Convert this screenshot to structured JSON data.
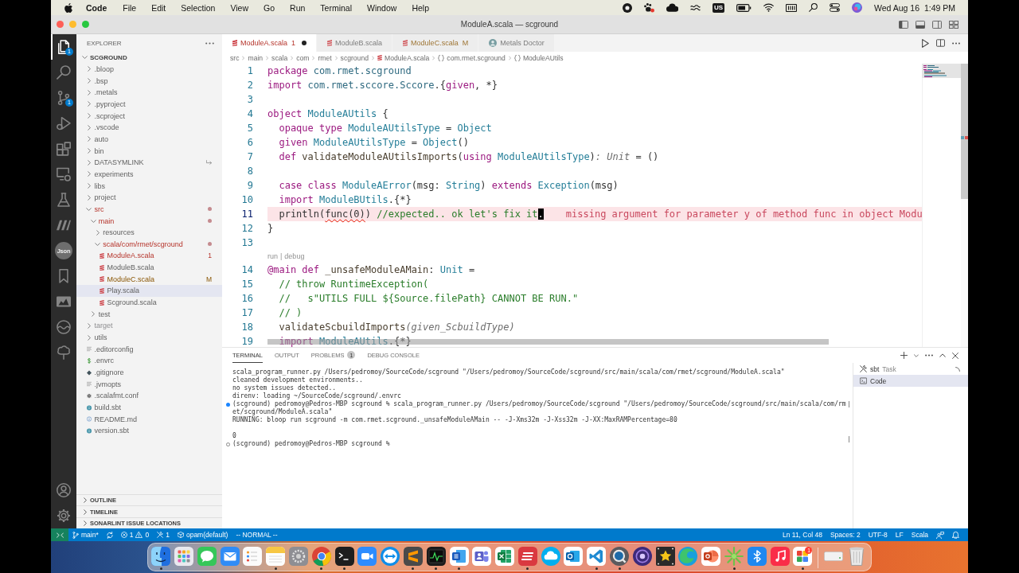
{
  "menubar": {
    "app": "Code",
    "menus": [
      "File",
      "Edit",
      "Selection",
      "View",
      "Go",
      "Run",
      "Terminal",
      "Window",
      "Help"
    ],
    "input_source": "US",
    "clock": "Wed Aug 16  1:49 PM"
  },
  "window": {
    "title": "ModuleA.scala — scground"
  },
  "activity_bar": {
    "items": [
      {
        "kind": "explorer",
        "selected": true,
        "badge": "1"
      },
      {
        "kind": "search",
        "selected": false
      },
      {
        "kind": "scm",
        "selected": false,
        "badge": "1"
      },
      {
        "kind": "debug",
        "selected": false
      },
      {
        "kind": "extensions",
        "selected": false
      },
      {
        "kind": "remote",
        "selected": false
      },
      {
        "kind": "testing",
        "selected": false
      },
      {
        "kind": "bars",
        "selected": false
      },
      {
        "kind": "json",
        "selected": false,
        "text": "Json"
      },
      {
        "kind": "bookmarks",
        "selected": false
      },
      {
        "kind": "image",
        "selected": false
      },
      {
        "kind": "wave",
        "selected": false
      },
      {
        "kind": "tree",
        "selected": false
      }
    ]
  },
  "sidebar": {
    "title": "EXPLORER",
    "root": {
      "label": "SCGROUND",
      "expanded": true,
      "children": [
        {
          "label": ".bloop",
          "kind": "folder",
          "expanded": false,
          "selected": false,
          "problems": false,
          "modified": false,
          "ignored": false
        },
        {
          "label": ".bsp",
          "kind": "folder",
          "expanded": false,
          "selected": false,
          "problems": false,
          "modified": false,
          "ignored": false
        },
        {
          "label": ".metals",
          "kind": "folder",
          "expanded": false,
          "selected": false,
          "problems": false,
          "modified": false,
          "ignored": false
        },
        {
          "label": ".pyproject",
          "kind": "folder",
          "expanded": false,
          "selected": false,
          "problems": false,
          "modified": false,
          "ignored": false
        },
        {
          "label": ".scproject",
          "kind": "folder",
          "expanded": false,
          "selected": false,
          "problems": false,
          "modified": false,
          "ignored": false
        },
        {
          "label": ".vscode",
          "kind": "folder",
          "expanded": false,
          "selected": false,
          "problems": false,
          "modified": false,
          "ignored": false
        },
        {
          "label": "auto",
          "kind": "folder",
          "expanded": false,
          "selected": false,
          "problems": false,
          "modified": false,
          "ignored": false
        },
        {
          "label": "bin",
          "kind": "folder",
          "expanded": false,
          "selected": false,
          "problems": false,
          "modified": false,
          "ignored": false
        },
        {
          "label": "DATASYMLINK",
          "kind": "link",
          "expanded": false,
          "selected": false,
          "problems": false,
          "modified": false,
          "ignored": false
        },
        {
          "label": "experiments",
          "kind": "folder",
          "expanded": false,
          "selected": false,
          "problems": false,
          "modified": false,
          "ignored": false
        },
        {
          "label": "libs",
          "kind": "folder",
          "expanded": false,
          "selected": false,
          "problems": false,
          "modified": false,
          "ignored": false
        },
        {
          "label": "project",
          "kind": "folder",
          "expanded": false,
          "selected": false,
          "problems": false,
          "modified": false,
          "ignored": false
        },
        {
          "label": "src",
          "kind": "folder",
          "expanded": true,
          "selected": false,
          "problems": true,
          "modified": false,
          "ignored": false,
          "children": [
            {
              "label": "main",
              "kind": "folder",
              "expanded": true,
              "selected": false,
              "problems": true,
              "modified": false,
              "ignored": false,
              "children": [
                {
                  "label": "resources",
                  "kind": "folder",
                  "expanded": false,
                  "selected": false,
                  "problems": false,
                  "modified": false,
                  "ignored": false
                },
                {
                  "label": "scala/com/rmet/scground",
                  "kind": "folder",
                  "expanded": true,
                  "selected": false,
                  "problems": true,
                  "modified": false,
                  "ignored": false,
                  "children": [
                    {
                      "label": "ModuleA.scala",
                      "kind": "scala",
                      "selected": false,
                      "problems": true,
                      "modified": false,
                      "ignored": false,
                      "badge": "1"
                    },
                    {
                      "label": "ModuleB.scala",
                      "kind": "scala",
                      "selected": false,
                      "problems": false,
                      "modified": false,
                      "ignored": false
                    },
                    {
                      "label": "ModuleC.scala",
                      "kind": "scala",
                      "selected": false,
                      "problems": false,
                      "modified": true,
                      "ignored": false,
                      "badge": "M"
                    },
                    {
                      "label": "Play.scala",
                      "kind": "scala",
                      "selected": true,
                      "problems": false,
                      "modified": false,
                      "ignored": false
                    },
                    {
                      "label": "Scground.scala",
                      "kind": "scala",
                      "selected": false,
                      "problems": false,
                      "modified": false,
                      "ignored": false
                    }
                  ]
                }
              ]
            },
            {
              "label": "test",
              "kind": "folder",
              "expanded": false,
              "selected": false,
              "problems": false,
              "modified": false,
              "ignored": false
            }
          ]
        },
        {
          "label": "target",
          "kind": "folder",
          "expanded": false,
          "selected": false,
          "problems": false,
          "modified": false,
          "ignored": true
        },
        {
          "label": "utils",
          "kind": "folder",
          "expanded": false,
          "selected": false,
          "problems": false,
          "modified": false,
          "ignored": false
        },
        {
          "label": ".editorconfig",
          "kind": "config",
          "selected": false,
          "problems": false,
          "modified": false,
          "ignored": false
        },
        {
          "label": ".envrc",
          "kind": "shell",
          "selected": false,
          "problems": false,
          "modified": false,
          "ignored": false
        },
        {
          "label": ".gitignore",
          "kind": "git",
          "selected": false,
          "problems": false,
          "modified": false,
          "ignored": false
        },
        {
          "label": ".jvmopts",
          "kind": "config",
          "selected": false,
          "problems": false,
          "modified": false,
          "ignored": false
        },
        {
          "label": ".scalafmt.conf",
          "kind": "gear",
          "selected": false,
          "problems": false,
          "modified": false,
          "ignored": false
        },
        {
          "label": "build.sbt",
          "kind": "sbt",
          "selected": false,
          "problems": false,
          "modified": false,
          "ignored": false
        },
        {
          "label": "README.md",
          "kind": "info",
          "selected": false,
          "problems": false,
          "modified": false,
          "ignored": false
        },
        {
          "label": "version.sbt",
          "kind": "sbt",
          "selected": false,
          "problems": false,
          "modified": false,
          "ignored": false
        }
      ]
    },
    "sections": [
      {
        "label": "OUTLINE",
        "expanded": false
      },
      {
        "label": "TIMELINE",
        "expanded": false
      },
      {
        "label": "SONARLINT ISSUE LOCATIONS",
        "expanded": false
      }
    ]
  },
  "editor": {
    "tabs": [
      {
        "label": "ModuleA.scala",
        "kind": "scala",
        "badge": "1",
        "problems": true,
        "modified": false,
        "dirty": true,
        "selected": true
      },
      {
        "label": "ModuleB.scala",
        "kind": "scala",
        "problems": false,
        "modified": false,
        "dirty": false,
        "selected": false
      },
      {
        "label": "ModuleC.scala",
        "kind": "scala",
        "badge": "M",
        "problems": false,
        "modified": true,
        "dirty": false,
        "selected": false
      },
      {
        "label": "Metals Doctor",
        "kind": "doctor",
        "problems": false,
        "modified": false,
        "dirty": false,
        "selected": false
      }
    ],
    "breadcrumbs": [
      {
        "label": "src",
        "kind": "folder"
      },
      {
        "label": "main",
        "kind": "folder"
      },
      {
        "label": "scala",
        "kind": "folder"
      },
      {
        "label": "com",
        "kind": "folder"
      },
      {
        "label": "rmet",
        "kind": "folder"
      },
      {
        "label": "scground",
        "kind": "folder"
      },
      {
        "label": "ModuleA.scala",
        "kind": "scala"
      },
      {
        "label": "com.rmet.scground",
        "kind": "package"
      },
      {
        "label": "ModuleAUtils",
        "kind": "package"
      }
    ],
    "lines": [
      {
        "kind": "code",
        "number": "1",
        "current": false,
        "tokens": [
          {
            "kind": "kw",
            "text": "package"
          },
          {
            "kind": "ns",
            "text": " com.rmet.scground"
          }
        ]
      },
      {
        "kind": "code",
        "number": "2",
        "current": false,
        "tokens": [
          {
            "kind": "kw",
            "text": "import"
          },
          {
            "kind": "ns",
            "text": " com.rmet.sccore.Sccore"
          },
          {
            "kind": "plain",
            "text": ".{"
          },
          {
            "kind": "kw",
            "text": "given"
          },
          {
            "kind": "plain",
            "text": ", *}"
          }
        ]
      },
      {
        "kind": "code",
        "number": "3",
        "current": false
      },
      {
        "kind": "code",
        "number": "4",
        "current": false,
        "tokens": [
          {
            "kind": "kw",
            "text": "object"
          },
          {
            "kind": "type",
            "text": " ModuleAUtils"
          },
          {
            "kind": "plain",
            "text": " {"
          }
        ]
      },
      {
        "kind": "code",
        "number": "5",
        "current": false,
        "tokens": [
          {
            "kind": "kw",
            "text": "  opaque type"
          },
          {
            "kind": "type",
            "text": " ModuleAUtilsType"
          },
          {
            "kind": "plain",
            "text": " = "
          },
          {
            "kind": "type",
            "text": "Object"
          }
        ]
      },
      {
        "kind": "code",
        "number": "6",
        "current": false,
        "tokens": [
          {
            "kind": "kw",
            "text": "  given"
          },
          {
            "kind": "type",
            "text": " ModuleAUtilsType"
          },
          {
            "kind": "plain",
            "text": " = "
          },
          {
            "kind": "type",
            "text": "Object"
          },
          {
            "kind": "plain",
            "text": "()"
          }
        ]
      },
      {
        "kind": "code",
        "number": "7",
        "current": false,
        "tokens": [
          {
            "kind": "kw",
            "text": "  def"
          },
          {
            "kind": "fn",
            "text": " validateModuleAUtilsImports"
          },
          {
            "kind": "plain",
            "text": "("
          },
          {
            "kind": "kw",
            "text": "using"
          },
          {
            "kind": "type",
            "text": " ModuleAUtilsType"
          },
          {
            "kind": "plain",
            "text": ")"
          },
          {
            "kind": "hint",
            "text": ": Unit"
          },
          {
            "kind": "plain",
            "text": " = ()"
          }
        ]
      },
      {
        "kind": "code",
        "number": "8",
        "current": false
      },
      {
        "kind": "code",
        "number": "9",
        "current": false,
        "tokens": [
          {
            "kind": "kw",
            "text": "  case class"
          },
          {
            "kind": "type",
            "text": " ModuleAError"
          },
          {
            "kind": "plain",
            "text": "(msg: "
          },
          {
            "kind": "type",
            "text": "String"
          },
          {
            "kind": "plain",
            "text": ") "
          },
          {
            "kind": "kw",
            "text": "extends"
          },
          {
            "kind": "type",
            "text": " Exception"
          },
          {
            "kind": "plain",
            "text": "(msg)"
          }
        ]
      },
      {
        "kind": "code",
        "number": "10",
        "current": false,
        "tokens": [
          {
            "kind": "kw",
            "text": "  import"
          },
          {
            "kind": "type",
            "text": " ModuleBUtils"
          },
          {
            "kind": "plain",
            "text": ".{*}"
          }
        ]
      },
      {
        "kind": "code",
        "number": "11",
        "current": true,
        "tokens": [
          {
            "kind": "plain",
            "text": "  println("
          },
          {
            "kind": "squiggle",
            "text": "func(0)"
          },
          {
            "kind": "plain",
            "text": ") "
          },
          {
            "kind": "comment",
            "text": "//expected.. ok let's fix it"
          },
          {
            "kind": "cursor",
            "text": "."
          }
        ],
        "diagnostic": "missing argument for parameter y of method func in object Modu"
      },
      {
        "kind": "code",
        "number": "12",
        "current": false,
        "tokens": [
          {
            "kind": "plain",
            "text": "}"
          }
        ]
      },
      {
        "kind": "code",
        "number": "13",
        "current": false
      },
      {
        "kind": "codelens",
        "links": [
          "run",
          "debug"
        ],
        "separator": "|"
      },
      {
        "kind": "code",
        "number": "14",
        "current": false,
        "tokens": [
          {
            "kind": "kw",
            "text": "@main def"
          },
          {
            "kind": "fn",
            "text": " _unsafeModuleAMain"
          },
          {
            "kind": "plain",
            "text": ": "
          },
          {
            "kind": "type",
            "text": "Unit"
          },
          {
            "kind": "plain",
            "text": " ="
          }
        ]
      },
      {
        "kind": "code",
        "number": "15",
        "current": false,
        "tokens": [
          {
            "kind": "comment",
            "text": "  // throw RuntimeException("
          }
        ]
      },
      {
        "kind": "code",
        "number": "16",
        "current": false,
        "tokens": [
          {
            "kind": "comment",
            "text": "  //   s\"UTILS FULL ${Source.filePath} CANNOT BE RUN.\""
          }
        ]
      },
      {
        "kind": "code",
        "number": "17",
        "current": false,
        "tokens": [
          {
            "kind": "comment",
            "text": "  // )"
          }
        ]
      },
      {
        "kind": "code",
        "number": "18",
        "current": false,
        "tokens": [
          {
            "kind": "fn",
            "text": "  validateScbuildImports"
          },
          {
            "kind": "hint",
            "text": "(given_ScbuildType)"
          }
        ]
      },
      {
        "kind": "code",
        "number": "19",
        "current": false,
        "tokens": [
          {
            "kind": "kw",
            "text": "  import"
          },
          {
            "kind": "type",
            "text": " ModuleAUtils"
          },
          {
            "kind": "plain",
            "text": ".{*}"
          }
        ]
      }
    ]
  },
  "panel": {
    "tabs": [
      {
        "label": "TERMINAL",
        "selected": true
      },
      {
        "label": "OUTPUT",
        "selected": false
      },
      {
        "label": "PROBLEMS",
        "selected": false,
        "badge": "1"
      },
      {
        "label": "DEBUG CONSOLE",
        "selected": false
      }
    ],
    "terminal": {
      "blocks": [
        {
          "lines": [
            {
              "kind": "output",
              "text": "scala_program_runner.py /Users/pedromoy/SourceCode/scground \"/Users/pedromoy/SourceCode/scground/src/main/scala/com/rmet/scground/ModuleA.scala\""
            },
            {
              "kind": "output",
              "text": "cleaned development environments.."
            },
            {
              "kind": "output",
              "text": "no system issues detected.."
            },
            {
              "kind": "output",
              "text": "direnv: loading ~/SourceCode/scground/.envrc"
            },
            {
              "kind": "command",
              "text": "(scground) pedromoy@Pedros-MBP scground % scala_program_runner.py /Users/pedromoy/SourceCode/scground \"/Users/pedromoy/SourceCode/scground/src/main/scala/com/rm"
            },
            {
              "kind": "output",
              "text": "et/scground/ModuleA.scala\""
            },
            {
              "kind": "output",
              "text": "RUNNING: bloop run scground -m com.rmet.scground._unsafeModuleAMain -- -J-Xms32m -J-Xss32m -J-XX:MaxRAMPercentage=80"
            }
          ]
        },
        {
          "lines": [
            {
              "kind": "output",
              "text": "0"
            },
            {
              "kind": "prompt",
              "text": "(scground) pedromoy@Pedros-MBP scground %"
            }
          ]
        }
      ]
    },
    "terminals": [
      {
        "label": "sbt",
        "detail": "Task",
        "kind": "task",
        "busy": true,
        "selected": false
      },
      {
        "label": "Code",
        "kind": "shell",
        "busy": false,
        "selected": true
      }
    ]
  },
  "status_bar": {
    "branch": "main*",
    "errors": "1",
    "warnings": "0",
    "tasks": "1",
    "environment": "opam(default)",
    "mode": "-- NORMAL --",
    "cursor": "Ln 11, Col 48",
    "indentation": "Spaces: 2",
    "encoding": "UTF-8",
    "eol": "LF",
    "language": "Scala"
  },
  "dock": {
    "apps": [
      {
        "kind": "smile",
        "running": true
      },
      {
        "kind": "grid",
        "running": false
      },
      {
        "kind": "chat",
        "running": false
      },
      {
        "kind": "envelope",
        "running": false
      },
      {
        "kind": "checklist",
        "running": false
      },
      {
        "kind": "notepad",
        "running": true
      },
      {
        "kind": "gear",
        "running": false
      },
      {
        "kind": "tricolor",
        "running": true
      },
      {
        "kind": "prompt",
        "running": true
      },
      {
        "kind": "camera",
        "running": false
      },
      {
        "kind": "arrows",
        "running": false
      },
      {
        "kind": "zigzag",
        "running": true
      },
      {
        "kind": "graph",
        "running": true
      },
      {
        "kind": "document",
        "running": true
      },
      {
        "kind": "people",
        "running": false
      },
      {
        "kind": "spreadsheet",
        "running": false
      },
      {
        "kind": "lines",
        "running": true
      },
      {
        "kind": "cloud",
        "running": false
      },
      {
        "kind": "ring",
        "running": false
      },
      {
        "kind": "ribbon",
        "running": true
      },
      {
        "kind": "lens",
        "running": true
      },
      {
        "kind": "target",
        "running": false
      },
      {
        "kind": "star",
        "running": false
      },
      {
        "kind": "swirl",
        "running": false
      },
      {
        "kind": "pie",
        "running": false
      },
      {
        "kind": "spark",
        "running": true
      },
      {
        "kind": "bluetooth",
        "running": false
      },
      {
        "kind": "note",
        "running": false
      },
      {
        "kind": "colorful",
        "running": true,
        "badge": "1"
      }
    ],
    "extras": [
      {
        "kind": "drive",
        "running": false
      },
      {
        "kind": "trash",
        "running": false
      }
    ]
  }
}
